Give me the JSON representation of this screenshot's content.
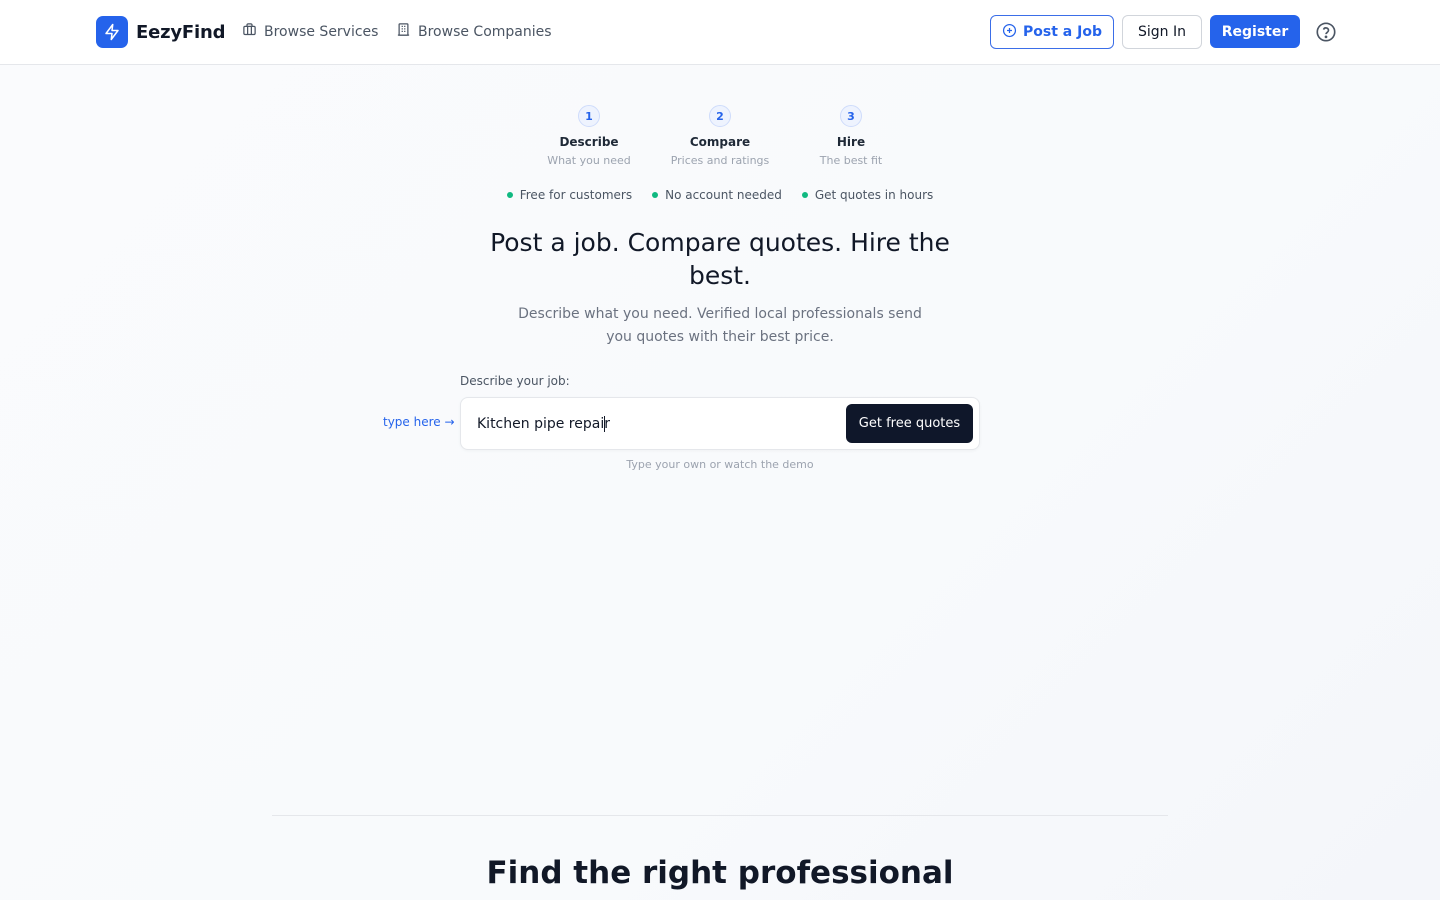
{
  "header": {
    "brand": "EezyFind",
    "nav": [
      {
        "label": "Browse Services",
        "icon": "briefcase-icon"
      },
      {
        "label": "Browse Companies",
        "icon": "building-icon"
      }
    ],
    "post_job_label": "Post a Job",
    "sign_in_label": "Sign In",
    "register_label": "Register"
  },
  "steps": [
    {
      "number": "1",
      "title": "Describe",
      "subtitle": "What you need"
    },
    {
      "number": "2",
      "title": "Compare",
      "subtitle": "Prices and ratings"
    },
    {
      "number": "3",
      "title": "Hire",
      "subtitle": "The best fit"
    }
  ],
  "benefits": [
    "Free for customers",
    "No account needed",
    "Get quotes in hours"
  ],
  "hero": {
    "title": "Post a job. Compare quotes. Hire the best.",
    "subtitle": "Describe what you need. Verified local professionals send you quotes with their best price."
  },
  "job_form": {
    "label": "Describe your job:",
    "hint": "type here →",
    "value": "Kitchen pipe repair",
    "submit_label": "Get free quotes",
    "note": "Type your own or watch the demo"
  },
  "next_section": {
    "title": "Find the right professional"
  },
  "colors": {
    "primary": "#2563eb",
    "dark_button": "#0f172a",
    "success_dot": "#10b981"
  }
}
